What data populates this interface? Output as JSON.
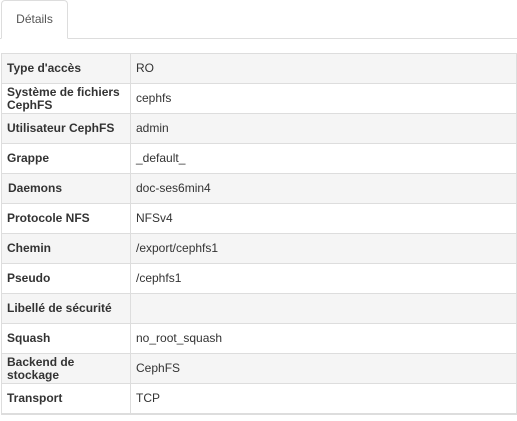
{
  "tabs": [
    {
      "label": "Détails"
    }
  ],
  "details": [
    {
      "label": "Type d'accès",
      "value": "RO"
    },
    {
      "label": "Système de fichiers CephFS",
      "value": "cephfs"
    },
    {
      "label": "Utilisateur CephFS",
      "value": "admin"
    },
    {
      "label": "Grappe",
      "value": "_default_"
    },
    {
      "label": "Daemons",
      "value": "doc-ses6min4"
    },
    {
      "label": "Protocole NFS",
      "value": "NFSv4"
    },
    {
      "label": "Chemin",
      "value": "/export/cephfs1"
    },
    {
      "label": "Pseudo",
      "value": "/cephfs1"
    },
    {
      "label": "Libellé de sécurité",
      "value": ""
    },
    {
      "label": "Squash",
      "value": "no_root_squash"
    },
    {
      "label": "Backend de stockage",
      "value": "CephFS"
    },
    {
      "label": "Transport",
      "value": "TCP"
    }
  ],
  "colors": {
    "border": "#dddddd",
    "stripe": "#f5f5f5",
    "text": "#333333"
  }
}
